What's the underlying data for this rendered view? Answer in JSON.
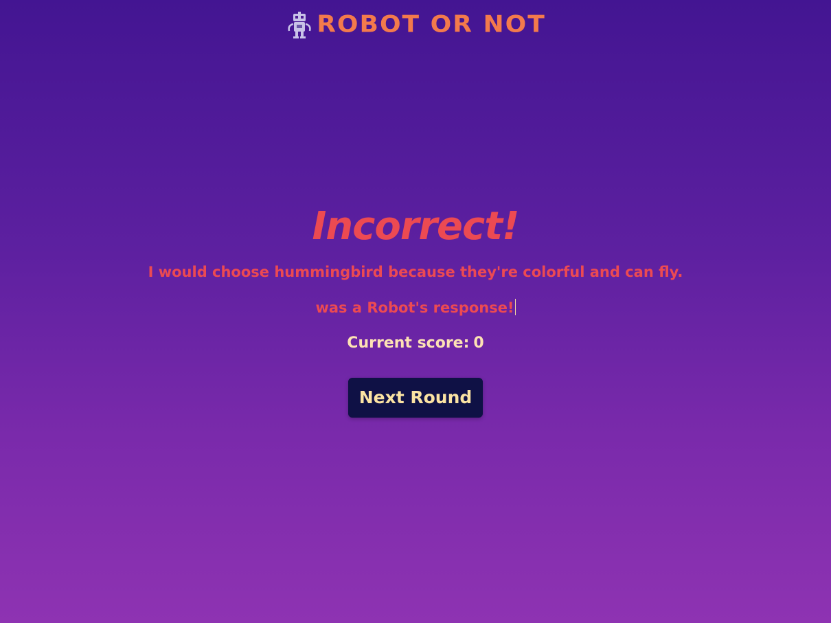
{
  "header": {
    "logo_icon": "robot-icon",
    "title": "ROBOT OR NOT"
  },
  "result": {
    "title": "Incorrect!",
    "response_text": "I would choose hummingbird because they're colorful and can fly.",
    "response_source": "was a Robot's response!",
    "score_label": "Current score:",
    "score_value": "0",
    "next_button_label": "Next Round"
  },
  "colors": {
    "background_top": "#431592",
    "background_bottom": "#8e33b2",
    "title_accent": "#f37a4c",
    "incorrect_red": "#ec4a52",
    "score_text": "#fde2b4",
    "button_bg": "#0f1145",
    "button_text": "#fbe3a3"
  }
}
